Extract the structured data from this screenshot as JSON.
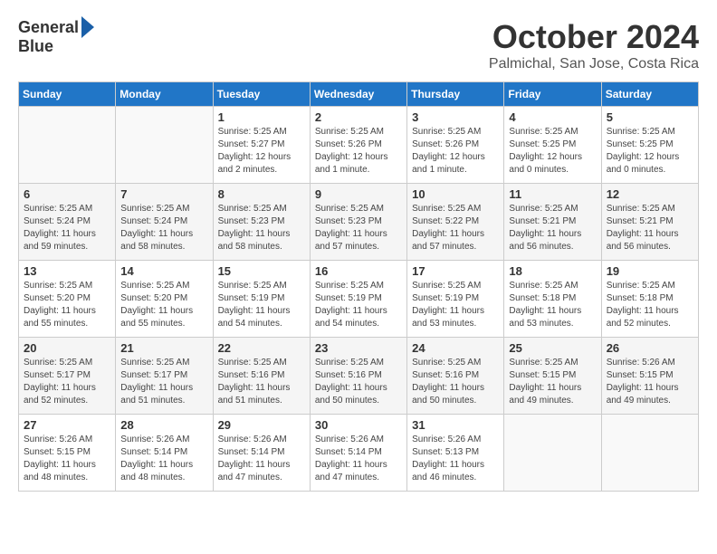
{
  "logo": {
    "line1": "General",
    "line2": "Blue"
  },
  "title": "October 2024",
  "location": "Palmichal, San Jose, Costa Rica",
  "days_of_week": [
    "Sunday",
    "Monday",
    "Tuesday",
    "Wednesday",
    "Thursday",
    "Friday",
    "Saturday"
  ],
  "weeks": [
    [
      {
        "day": "",
        "sunrise": "",
        "sunset": "",
        "daylight": ""
      },
      {
        "day": "",
        "sunrise": "",
        "sunset": "",
        "daylight": ""
      },
      {
        "day": "1",
        "sunrise": "Sunrise: 5:25 AM",
        "sunset": "Sunset: 5:27 PM",
        "daylight": "Daylight: 12 hours and 2 minutes."
      },
      {
        "day": "2",
        "sunrise": "Sunrise: 5:25 AM",
        "sunset": "Sunset: 5:26 PM",
        "daylight": "Daylight: 12 hours and 1 minute."
      },
      {
        "day": "3",
        "sunrise": "Sunrise: 5:25 AM",
        "sunset": "Sunset: 5:26 PM",
        "daylight": "Daylight: 12 hours and 1 minute."
      },
      {
        "day": "4",
        "sunrise": "Sunrise: 5:25 AM",
        "sunset": "Sunset: 5:25 PM",
        "daylight": "Daylight: 12 hours and 0 minutes."
      },
      {
        "day": "5",
        "sunrise": "Sunrise: 5:25 AM",
        "sunset": "Sunset: 5:25 PM",
        "daylight": "Daylight: 12 hours and 0 minutes."
      }
    ],
    [
      {
        "day": "6",
        "sunrise": "Sunrise: 5:25 AM",
        "sunset": "Sunset: 5:24 PM",
        "daylight": "Daylight: 11 hours and 59 minutes."
      },
      {
        "day": "7",
        "sunrise": "Sunrise: 5:25 AM",
        "sunset": "Sunset: 5:24 PM",
        "daylight": "Daylight: 11 hours and 58 minutes."
      },
      {
        "day": "8",
        "sunrise": "Sunrise: 5:25 AM",
        "sunset": "Sunset: 5:23 PM",
        "daylight": "Daylight: 11 hours and 58 minutes."
      },
      {
        "day": "9",
        "sunrise": "Sunrise: 5:25 AM",
        "sunset": "Sunset: 5:23 PM",
        "daylight": "Daylight: 11 hours and 57 minutes."
      },
      {
        "day": "10",
        "sunrise": "Sunrise: 5:25 AM",
        "sunset": "Sunset: 5:22 PM",
        "daylight": "Daylight: 11 hours and 57 minutes."
      },
      {
        "day": "11",
        "sunrise": "Sunrise: 5:25 AM",
        "sunset": "Sunset: 5:21 PM",
        "daylight": "Daylight: 11 hours and 56 minutes."
      },
      {
        "day": "12",
        "sunrise": "Sunrise: 5:25 AM",
        "sunset": "Sunset: 5:21 PM",
        "daylight": "Daylight: 11 hours and 56 minutes."
      }
    ],
    [
      {
        "day": "13",
        "sunrise": "Sunrise: 5:25 AM",
        "sunset": "Sunset: 5:20 PM",
        "daylight": "Daylight: 11 hours and 55 minutes."
      },
      {
        "day": "14",
        "sunrise": "Sunrise: 5:25 AM",
        "sunset": "Sunset: 5:20 PM",
        "daylight": "Daylight: 11 hours and 55 minutes."
      },
      {
        "day": "15",
        "sunrise": "Sunrise: 5:25 AM",
        "sunset": "Sunset: 5:19 PM",
        "daylight": "Daylight: 11 hours and 54 minutes."
      },
      {
        "day": "16",
        "sunrise": "Sunrise: 5:25 AM",
        "sunset": "Sunset: 5:19 PM",
        "daylight": "Daylight: 11 hours and 54 minutes."
      },
      {
        "day": "17",
        "sunrise": "Sunrise: 5:25 AM",
        "sunset": "Sunset: 5:19 PM",
        "daylight": "Daylight: 11 hours and 53 minutes."
      },
      {
        "day": "18",
        "sunrise": "Sunrise: 5:25 AM",
        "sunset": "Sunset: 5:18 PM",
        "daylight": "Daylight: 11 hours and 53 minutes."
      },
      {
        "day": "19",
        "sunrise": "Sunrise: 5:25 AM",
        "sunset": "Sunset: 5:18 PM",
        "daylight": "Daylight: 11 hours and 52 minutes."
      }
    ],
    [
      {
        "day": "20",
        "sunrise": "Sunrise: 5:25 AM",
        "sunset": "Sunset: 5:17 PM",
        "daylight": "Daylight: 11 hours and 52 minutes."
      },
      {
        "day": "21",
        "sunrise": "Sunrise: 5:25 AM",
        "sunset": "Sunset: 5:17 PM",
        "daylight": "Daylight: 11 hours and 51 minutes."
      },
      {
        "day": "22",
        "sunrise": "Sunrise: 5:25 AM",
        "sunset": "Sunset: 5:16 PM",
        "daylight": "Daylight: 11 hours and 51 minutes."
      },
      {
        "day": "23",
        "sunrise": "Sunrise: 5:25 AM",
        "sunset": "Sunset: 5:16 PM",
        "daylight": "Daylight: 11 hours and 50 minutes."
      },
      {
        "day": "24",
        "sunrise": "Sunrise: 5:25 AM",
        "sunset": "Sunset: 5:16 PM",
        "daylight": "Daylight: 11 hours and 50 minutes."
      },
      {
        "day": "25",
        "sunrise": "Sunrise: 5:25 AM",
        "sunset": "Sunset: 5:15 PM",
        "daylight": "Daylight: 11 hours and 49 minutes."
      },
      {
        "day": "26",
        "sunrise": "Sunrise: 5:26 AM",
        "sunset": "Sunset: 5:15 PM",
        "daylight": "Daylight: 11 hours and 49 minutes."
      }
    ],
    [
      {
        "day": "27",
        "sunrise": "Sunrise: 5:26 AM",
        "sunset": "Sunset: 5:15 PM",
        "daylight": "Daylight: 11 hours and 48 minutes."
      },
      {
        "day": "28",
        "sunrise": "Sunrise: 5:26 AM",
        "sunset": "Sunset: 5:14 PM",
        "daylight": "Daylight: 11 hours and 48 minutes."
      },
      {
        "day": "29",
        "sunrise": "Sunrise: 5:26 AM",
        "sunset": "Sunset: 5:14 PM",
        "daylight": "Daylight: 11 hours and 47 minutes."
      },
      {
        "day": "30",
        "sunrise": "Sunrise: 5:26 AM",
        "sunset": "Sunset: 5:14 PM",
        "daylight": "Daylight: 11 hours and 47 minutes."
      },
      {
        "day": "31",
        "sunrise": "Sunrise: 5:26 AM",
        "sunset": "Sunset: 5:13 PM",
        "daylight": "Daylight: 11 hours and 46 minutes."
      },
      {
        "day": "",
        "sunrise": "",
        "sunset": "",
        "daylight": ""
      },
      {
        "day": "",
        "sunrise": "",
        "sunset": "",
        "daylight": ""
      }
    ]
  ]
}
